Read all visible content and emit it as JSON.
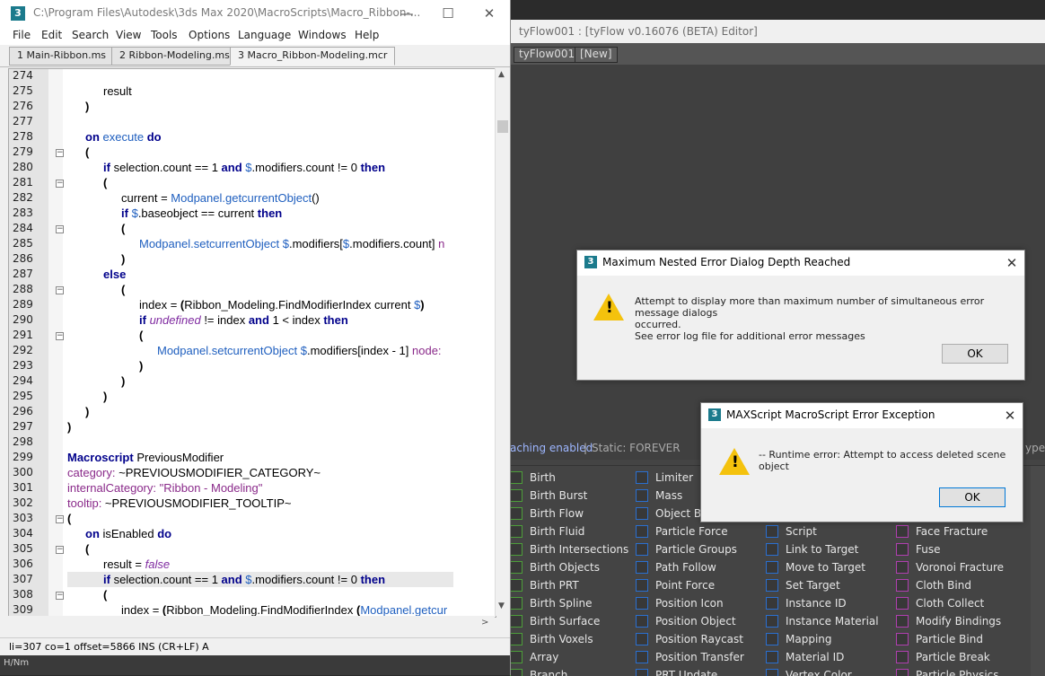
{
  "editor": {
    "title": "C:\\Program Files\\Autodesk\\3ds Max 2020\\MacroScripts\\Macro_Ribbon-...",
    "app_icon": "3",
    "window_controls": {
      "minimize": "—",
      "maximize": "☐",
      "close": "✕"
    },
    "menu": [
      "File",
      "Edit",
      "Search",
      "View",
      "Tools",
      "Options",
      "Language",
      "Windows",
      "Help"
    ],
    "tabs": [
      "1 Main-Ribbon.ms",
      "2 Ribbon-Modeling.ms",
      "3 Macro_Ribbon-Modeling.mcr"
    ],
    "active_tab": 2,
    "line_numbers": [
      "274",
      "275",
      "276",
      "277",
      "278",
      "279",
      "280",
      "281",
      "282",
      "283",
      "284",
      "285",
      "286",
      "287",
      "288",
      "289",
      "290",
      "291",
      "292",
      "293",
      "294",
      "295",
      "296",
      "297",
      "298",
      "299",
      "300",
      "301",
      "302",
      "303",
      "304",
      "305",
      "306",
      "307",
      "308",
      "309"
    ],
    "status": "li=307 co=1 offset=5866 INS (CR+LF) A",
    "viewport_label": "H/Nm"
  },
  "tyflow": {
    "title": "tyFlow001 : [tyFlow v0.16076 (BETA) Editor]",
    "tabs": [
      "tyFlow001",
      "[New]"
    ],
    "status_part1": "aching enabled",
    "status_sep": "|",
    "status_part2": "Static: FOREVER",
    "status_suffix": "ype",
    "ops_col1": [
      "Birth",
      "Birth Burst",
      "Birth Flow",
      "Birth Fluid",
      "Birth Intersections",
      "Birth Objects",
      "Birth PRT",
      "Birth Spline",
      "Birth Surface",
      "Birth Voxels",
      "Array",
      "Branch"
    ],
    "ops_col2": [
      "Limiter",
      "Mass",
      "Object B",
      "Particle Force",
      "Particle Groups",
      "Path Follow",
      "Point Force",
      "Position Icon",
      "Position Object",
      "Position Raycast",
      "Position Transfer",
      "PRT Update"
    ],
    "ops_col3": [
      "Script",
      "Link to Target",
      "Move to Target",
      "Set Target",
      "Instance ID",
      "Instance Material",
      "Mapping",
      "Material ID",
      "Vertex Color"
    ],
    "ops_col4": [
      "Face Fracture",
      "Fuse",
      "Voronoi Fracture",
      "Cloth Bind",
      "Cloth Collect",
      "Modify Bindings",
      "Particle Bind",
      "Particle Break",
      "Particle Physics"
    ]
  },
  "dialog_depth": {
    "title": "Maximum Nested Error Dialog Depth Reached",
    "close": "✕",
    "line1": "Attempt to display more than maximum number of simultaneous error message dialogs",
    "line2": "occurred.",
    "line3": "See error log file for additional error messages",
    "ok": "OK",
    "icon": "!"
  },
  "dialog_exception": {
    "title": "MAXScript MacroScript Error Exception",
    "close": "✕",
    "message": "-- Runtime error: Attempt to access deleted scene object",
    "ok": "OK",
    "icon": "!"
  },
  "colors": {
    "keyword": "#00008b",
    "function": "#1f5fbf",
    "warning": "#f4c20d"
  }
}
